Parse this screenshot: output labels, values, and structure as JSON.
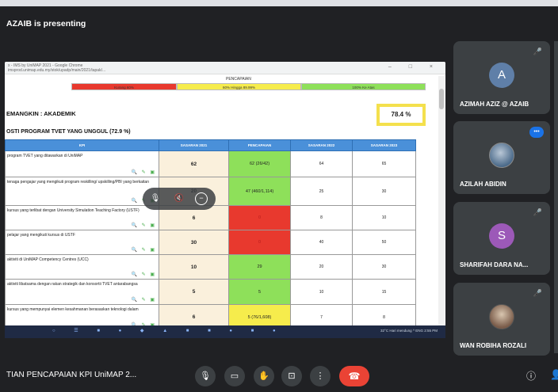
{
  "banner": {
    "presenting": "AZAIB is presenting"
  },
  "share": {
    "browser_title": "x - IMS by UniMAP 2021 - Google Chrome",
    "url": "imsprod.unimap.edu.my/stok/upadp/main/2021/tapak/...",
    "legend_title": "PENCAPAIAN",
    "legend": [
      "Kurang 60%",
      "60% Hingga 89.99%",
      "100% Ke Atas"
    ],
    "legend_colors": [
      "#e8392e",
      "#f6ec4c",
      "#8ee05a"
    ],
    "heading": "EMANGKIN : AKADEMIK",
    "subheading": "OSTI PROGRAM TVET YANG UNGGUL      (72.9 %)",
    "score": "78.4 %",
    "columns": [
      "KPI",
      "SASARAN 2021",
      "PENCAPAIAN",
      "SASARAN 2022",
      "SASARAN 2023"
    ],
    "rows": [
      {
        "desc": "program TVET yang ditawarkan di UniMAP",
        "t2021": "62",
        "ach": "62 (26/42)",
        "status": "green",
        "t2022": "64",
        "t2023": "65"
      },
      {
        "desc": "tenaga pengajar yang mengikuti program reskilling/ upskilling/PBI yang berkaitan",
        "t2021": "20",
        "ach": "47 (460/1,114)",
        "status": "green",
        "t2022": "25",
        "t2023": "30"
      },
      {
        "desc": "kursus yang terlibat dengan University Simulation Teaching Factory (USTF)",
        "t2021": "6",
        "ach": "0",
        "status": "red",
        "t2022": "8",
        "t2023": "10"
      },
      {
        "desc": "pelajar yang mengikuti kursus di USTF",
        "t2021": "30",
        "ach": "0",
        "status": "red",
        "t2022": "40",
        "t2023": "50"
      },
      {
        "desc": "aktiviti di UniMAP Competency Centres (UCC)",
        "t2021": "10",
        "ach": "29",
        "status": "green",
        "t2022": "20",
        "t2023": "30"
      },
      {
        "desc": "aktiviti libatsama dengan rakan strategik dan konsortii TVET antarabangsa",
        "t2021": "5",
        "ach": "5",
        "status": "green",
        "t2022": "10",
        "t2023": "15"
      },
      {
        "desc": "kursus yang mempunyai elemen kesahmanan berasaskan teknologi dalam",
        "t2021": "6",
        "ach": "5 (76/1,608)",
        "status": "yellow",
        "t2022": "7",
        "t2023": "8"
      }
    ],
    "tray_text": "32°C Hari mendung   ^  ENG   2:55 PM"
  },
  "participants": [
    {
      "name": "AZIMAH AZIZ @ AZAIB",
      "initial": "A",
      "color": "#5f7fa8",
      "icon": "mic-off-icon"
    },
    {
      "name": "AZILAH ABIDIN",
      "initial": "",
      "color": "#4b6a8a",
      "icon": "speaking-icon"
    },
    {
      "name": "SHARIFAH DARA NA...",
      "initial": "S",
      "color": "#9c59b8",
      "icon": "mic-off-icon"
    },
    {
      "name": "WAN ROBIHA ROZALI",
      "initial": "",
      "color": "#7a5c4a",
      "icon": "mic-off-icon"
    }
  ],
  "bottombar": {
    "meeting_title": "TIAN PENCAPAIAN KPI UniMAP 2..."
  }
}
